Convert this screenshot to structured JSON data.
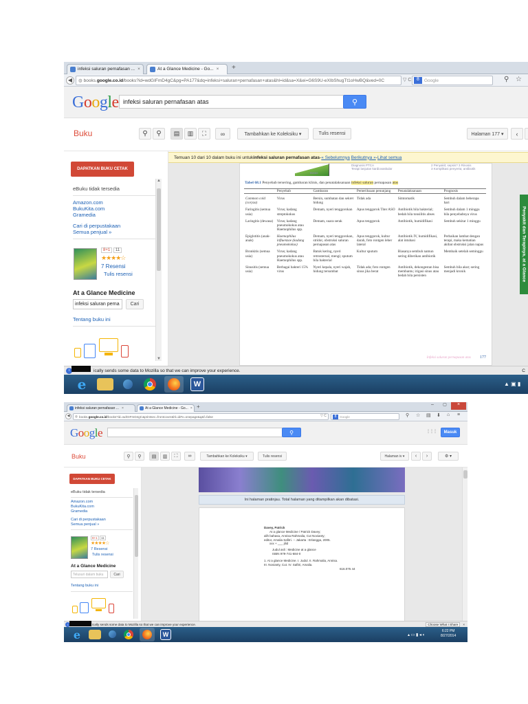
{
  "s1": {
    "tabs": [
      {
        "label": "infeksi saluran pernafasan ..."
      },
      {
        "label": "At a Glance Medicine - Go..."
      }
    ],
    "new_tab": "+",
    "tab_close": "×",
    "url": {
      "prefix": "books.",
      "domain": "google.co.id",
      "rest": "/books?id=wdGIFmD4gC&pg=PA177&dq=infeksi+saluran+pernafasan+atas&hl=id&sa=X&ei=G6S9U-eXIbShugTt1oHwBQ&ved=0C",
      "right": "▽ C",
      "search_placeholder": "Google"
    },
    "google": {
      "query": "infeksi saluran pernafasan atas"
    },
    "toolbar": {
      "buku": "Buku",
      "koleksi": "Tambahkan ke Koleksiku ▾",
      "ulasan": "Tulis resensi",
      "page": "Halaman 177 ▾"
    },
    "notice": {
      "text": "Temuan 10 dari 10 dalam buku ini untuk ",
      "bold": "infeksi saluran pernafasan atas",
      "sep": " - ",
      "prev": "« Sebelumnya",
      "next": "Berikutnya »",
      "all": "Lihat semua"
    },
    "sidebar": {
      "buy": "DAPATKAN BUKU CETAK",
      "ebook": "eBuku tidak tersedia",
      "stores": [
        "Amazon.com",
        "BukuKita.com",
        "Gramedia"
      ],
      "library": "Cari di perpustakaan",
      "sellers": "Semua penjual »",
      "rating_plus": "8+1",
      "rating_count": "11",
      "stars": "★★★★☆",
      "reviews": "7 Resensi",
      "write": "Tulis resensi",
      "title": "At a Glance Medicine",
      "search_value": "infeksi saluran perna",
      "search_btn": "Cari",
      "about": "Tentang buku ini"
    },
    "figure_labels": [
      "Diagnosis PTCA",
      "Terapi lanjutan kardiovaskular",
      "2 Penyakit; sepsis? 3 Rinosis",
      "3 Komplikasi penyerta; antibiotik",
      "Batas"
    ],
    "table": {
      "caption_label": "Tabel 68.1",
      "caption_text": "Penyebab tersering, gambaran klinis, dan penatalaksanaan",
      "caption_hl": "infeksi saluran",
      "caption_end": "pernapasan",
      "caption_hl2": "atas",
      "headers": [
        "",
        "Penyebab",
        "Gambaran",
        "Pemeriksaan penunjang",
        "Penatalaksanaan",
        "Prognosis"
      ],
      "rows": [
        [
          "Common cold (coryza)",
          "Virus",
          "Bersin, sumbatan dan sekret hidung",
          "Tidak ada",
          "Simtomatik",
          "Sembuh dalam beberapa hari"
        ],
        [
          "Faringitis (semua usia)",
          "Virus; kadang streptokokus",
          "Demam, nyeri tenggorokan",
          "Apus tenggorok Titer ASO",
          "Antibiotik bila bakterial; bedah bila tonsilitis abses",
          "Sembuh dalam 1 minggu bila penyebabnya virus"
        ],
        [
          "Laringitis (dewasa)",
          "Virus; kadang pneumokokus atau Haemophilus spp.",
          "Demam, suara serak",
          "Apus tenggorok",
          "Antibiotik, humidifikasi",
          "Sembuh sekitar 1 minggu"
        ],
        [
          "Epiglotitis (anak-anak)",
          "Haemophilus influenzae (kadang pneumokokus)",
          "Demam, nyeri tenggorokan, stridor, obstruksi saluran pernapasan atas",
          "Apus tenggorok, kultur darah, foto rontgen leher lateral",
          "Antibiotik IV, humidifikasi, alat intubasi",
          "Perbaikan lambat dengan terapi, maka kematian akibat obstruksi jalan napas"
        ],
        [
          "Bronkitis (semua usia)",
          "Virus; kadang pneumokokus atau Haemophilus spp.",
          "Batuk kering, nyeri retrosternal, mengi; sputum bila bakterial",
          "Kultur sputum",
          "Biasanya sembuh namun sering diberikan antibiotik",
          "Membaik setelah seminggu"
        ],
        [
          "Sinusitis (semua usia)",
          "Berbagai bakteri 15% virus",
          "Nyeri kepala, nyeri wajah, hidung tersumbat",
          "Tidak ada; foto rontgen sinus jika berat",
          "Antibiotik, dekongestan bisa membantu; irigasi sinus atau bedah bila persisten",
          "Sembuh bila akut; sering menjadi kronik"
        ]
      ],
      "footer": "Infeksi saluran pernapasan atas",
      "page_number": "177"
    },
    "green_tab": "Penyakit dan Terapinya, at a Glance",
    "mozilla_bar": "ically sends some data to Mozilla so that we can improve your experience.",
    "mozilla_right": "C",
    "tray": "▲ ▣ ▮"
  },
  "s2": {
    "tabs": [
      {
        "label": "infeksi saluran pernafasan ..."
      },
      {
        "label": "At a Glance Medicine - Go..."
      }
    ],
    "new_tab": "+",
    "tab_close": "×",
    "window_controls": [
      "–",
      "▢",
      "×"
    ],
    "url": {
      "prefix": "books.",
      "domain": "google.co.id",
      "rest": "/books?id=wdGIFmD4gC&printsec=frontcover&hl=id#v=onepage&q&f=false",
      "right": "▽ C",
      "search_placeholder": "Google"
    },
    "nav_icons": [
      "☆",
      "▤",
      "⬇",
      "⌂",
      "≡"
    ],
    "google": {
      "query": ""
    },
    "apps_icon": "⋮⋮⋮",
    "masuk": "Masuk",
    "toolbar": {
      "buku": "Buku",
      "koleksi": "Tambahkan ke Koleksiku ▾",
      "ulasan": "Tulis resensi",
      "page": "Halaman iv ▾",
      "settings": "⚙ ▾"
    },
    "sidebar": {
      "buy": "DAPATKAN BUKU CETAK",
      "ebook": "eBuku tidak tersedia",
      "stores": [
        "Amazon.com",
        "BukuKita.com",
        "Gramedia"
      ],
      "library": "Cari di perpustakaan",
      "sellers": "Semua penjual »",
      "rating_plus": "8+1",
      "rating_count": "11",
      "stars": "★★★★☆",
      "reviews": "7 Resensi",
      "write": "Tulis resensi",
      "title": "At a Glance Medicine",
      "search_placeholder": "Telusuri dalam buku",
      "search_btn": "Cari",
      "about": "Tentang buku ini"
    },
    "preview_notice": "Ini halaman pratinjau. Total halaman yang ditampilkan akan dibatasi.",
    "catalog": [
      "Davey, Patrick",
      "At a glance Medicine / Patrick Davey;",
      "alih bahasa, Annisa Rahmalia, Cut Novianty;",
      "editor, Amalia Safitri. -- Jakarta : Erlangga, 2005.",
      "xxx + ___ jilid",
      "Judul asli : Medicine at a glance",
      "ISBN 979-741-684-0",
      "1. At a glance Medicine.    I. Judul.    II. Rahmalia, Annisa.",
      "III. Novianty, Cut.    IV. Safitri, Amalia.",
      "616.075 44"
    ],
    "mozilla_bar": "ically sends some data to Mozilla so that we can improve your experience.",
    "choose": "Choose What I Share",
    "close": "×",
    "clock": {
      "time": "6:22 PM",
      "date": "8/27/2014"
    }
  }
}
